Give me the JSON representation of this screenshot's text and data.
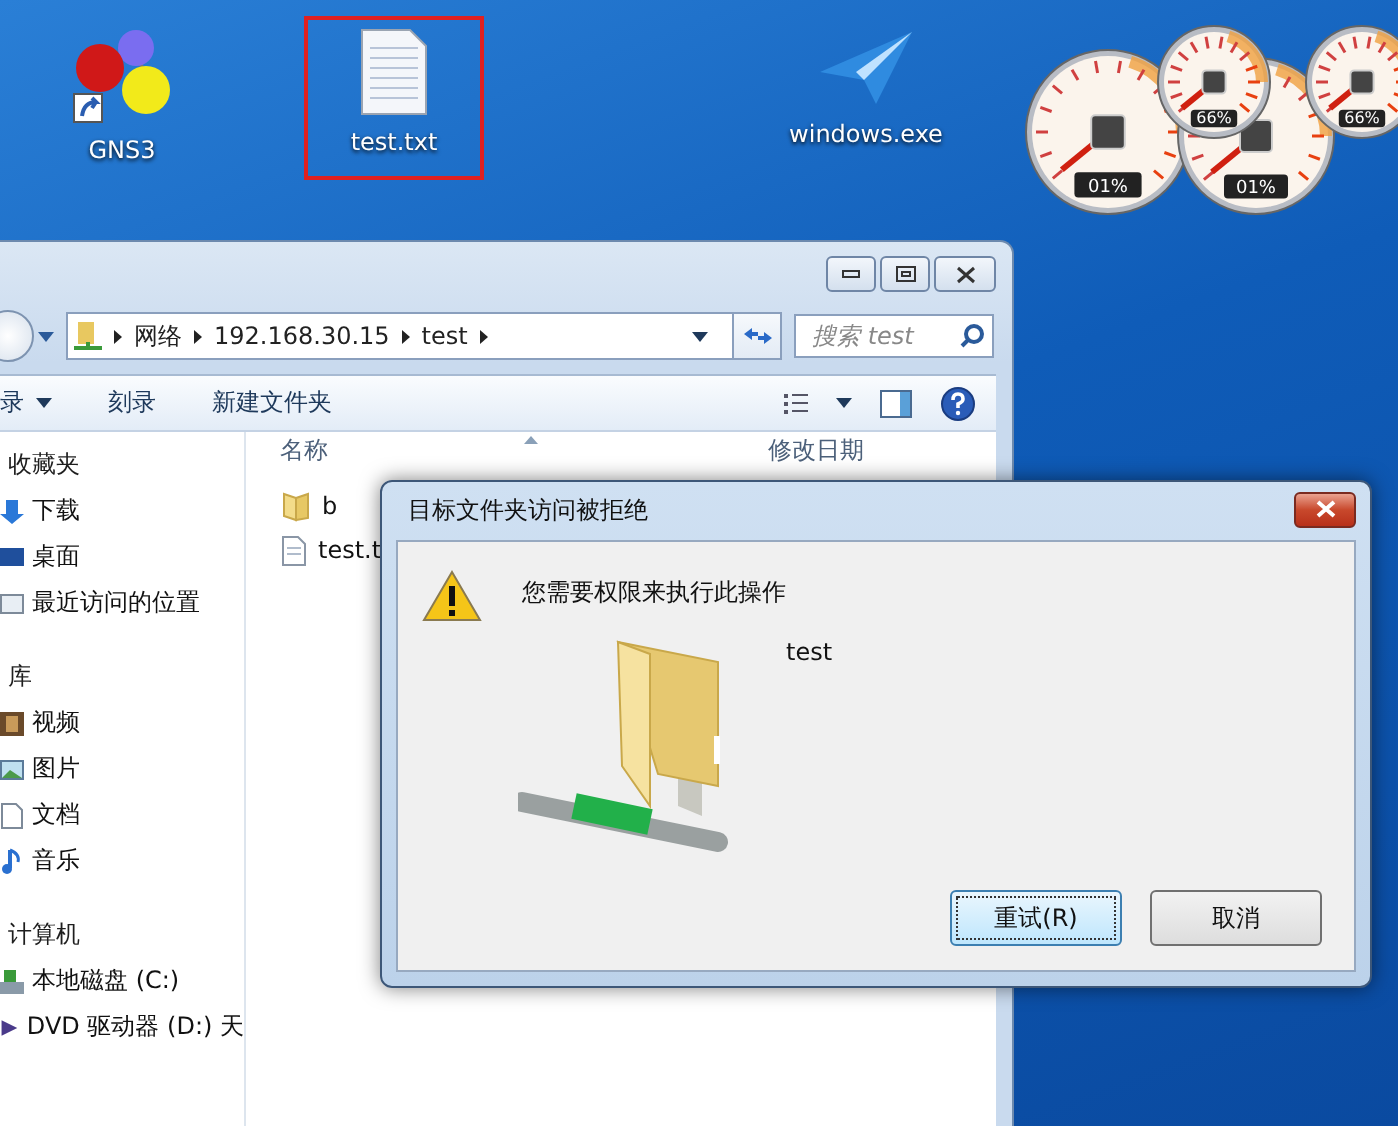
{
  "desktop_icons": [
    {
      "label": "GNS3",
      "kind": "app",
      "selected": false
    },
    {
      "label": "test.txt",
      "kind": "text",
      "selected": true
    },
    {
      "label": "windows.exe",
      "kind": "exe",
      "selected": false
    }
  ],
  "gadgets": [
    {
      "kind": "cpu",
      "reading": "01%"
    },
    {
      "kind": "memory",
      "reading": "66%"
    },
    {
      "kind": "cpu",
      "reading": "01%"
    },
    {
      "kind": "memory",
      "reading": "66%"
    }
  ],
  "explorer": {
    "breadcrumb": [
      "网络",
      "192.168.30.15",
      "test"
    ],
    "search": {
      "placeholder": "搜索 test"
    },
    "toolbar": [
      {
        "label": "录",
        "dropdown": true
      },
      {
        "label": "刻录",
        "dropdown": false
      },
      {
        "label": "新建文件夹",
        "dropdown": false
      }
    ],
    "sidebar": [
      {
        "title": "收藏夹",
        "items": [
          {
            "label": "下载",
            "kind": "download"
          },
          {
            "label": "桌面",
            "kind": "desktop"
          },
          {
            "label": "最近访问的位置",
            "kind": "recent"
          }
        ]
      },
      {
        "title": "库",
        "items": [
          {
            "label": "视频",
            "kind": "video"
          },
          {
            "label": "图片",
            "kind": "picture"
          },
          {
            "label": "文档",
            "kind": "document"
          },
          {
            "label": "音乐",
            "kind": "music"
          }
        ]
      },
      {
        "title": "计算机",
        "items": [
          {
            "label": "本地磁盘 (C:)",
            "kind": "disk"
          },
          {
            "label": "DVD 驱动器 (D:) 天",
            "kind": "dvd"
          }
        ]
      }
    ],
    "columns": [
      "名称",
      "修改日期"
    ],
    "files": [
      {
        "name": "b",
        "kind": "folder"
      },
      {
        "name": "test.t",
        "kind": "file"
      }
    ]
  },
  "dialog": {
    "title": "目标文件夹访问被拒绝",
    "message": "您需要权限来执行此操作",
    "item": "test",
    "buttons": [
      {
        "label": "重试(R)",
        "default": true
      },
      {
        "label": "取消",
        "default": false
      }
    ]
  }
}
